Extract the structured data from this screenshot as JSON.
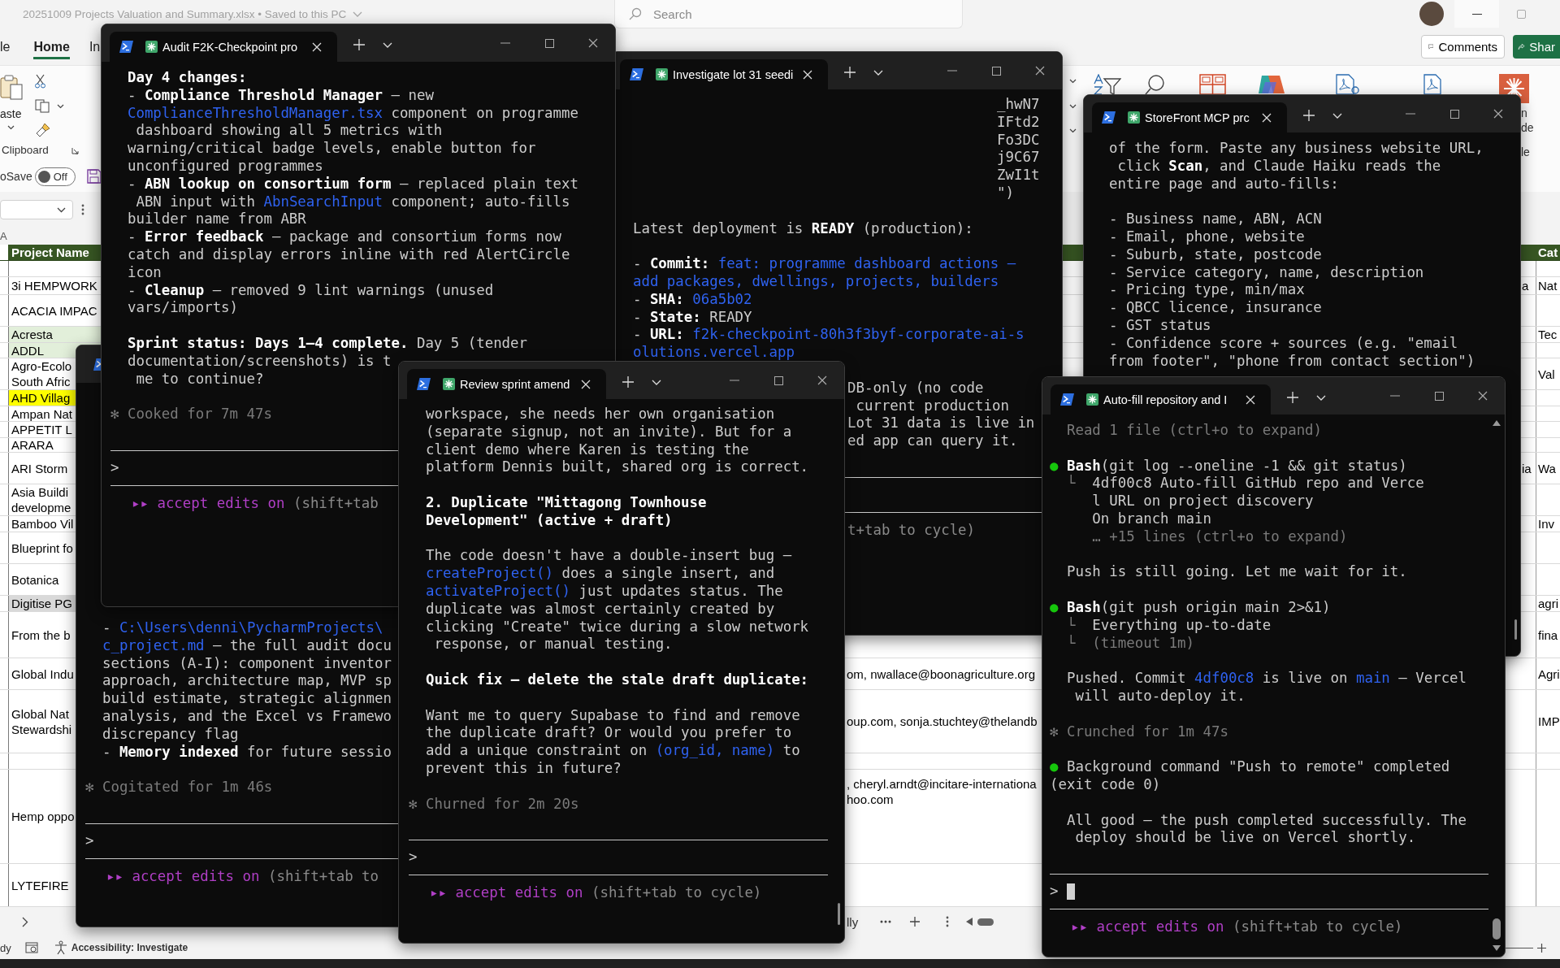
{
  "excel": {
    "title": "20251009 Projects Valuation and Summary.xlsx • Saved to this PC",
    "search": {
      "placeholder": "Search"
    },
    "ribbon_tabs": [
      {
        "label": "le",
        "selected": false
      },
      {
        "label": "Home",
        "selected": true
      },
      {
        "label": "In",
        "selected": false
      }
    ],
    "comments": "Comments",
    "share": "Shar",
    "clipboard": {
      "paste": "aste",
      "group": "Clipboard"
    },
    "ribbon_fragments": [
      "n",
      "de",
      "le"
    ],
    "autosave": {
      "label": "oSave",
      "on": false,
      "state": "Off"
    },
    "column_header": "A",
    "sheet": {
      "header": "Project Name",
      "category_header": "Cat",
      "rows": [
        {
          "project_name": [
            "3i HEMPWORK"
          ],
          "prev": "a",
          "category": "Nat",
          "space_before": true
        },
        {
          "project_name": [
            "ACACIA IMPAC"
          ]
        },
        {
          "project_name": [
            "Acresta"
          ],
          "color": "#e2efda",
          "category": "Tec"
        },
        {
          "project_name": [
            "ADDL"
          ],
          "color": "#e2efda"
        },
        {
          "project_name": [
            "Agro-Ecolo",
            "South Afric"
          ],
          "category": "Val"
        },
        {
          "project_name": [
            "AHD Villag"
          ],
          "color": "#ffff00"
        },
        {
          "project_name": [
            "Ampan Nat"
          ]
        },
        {
          "project_name": [
            "APPETIT L"
          ]
        },
        {
          "project_name": [
            "ARARA"
          ]
        },
        {
          "project_name": [
            "ARI Storm"
          ],
          "prev": "ia",
          "category": "Wa"
        },
        {
          "project_name": [
            "Asia Buildi",
            "developme"
          ]
        },
        {
          "project_name": [
            "Bamboo Vil"
          ],
          "category": "Inv"
        },
        {
          "project_name": [
            "Blueprint fo"
          ]
        },
        {
          "project_name": [
            "Botanica"
          ]
        },
        {
          "project_name": [
            "Digitise PG"
          ],
          "color": "#d9d9d9",
          "category": "agri"
        },
        {
          "project_name": [
            "From the b"
          ],
          "category": "fina"
        },
        {
          "project_name": [
            "Global Indu"
          ],
          "contact": [
            "om, nwallace@boonagriculture.org"
          ],
          "category": "Agri"
        },
        {
          "project_name": [
            "Global Nat",
            "Stewardshi"
          ],
          "contact": [
            "oup.com, sonja.stuchtey@thelandb"
          ],
          "category": "IMP"
        },
        {
          "project_name": [
            "Hemp oppo"
          ],
          "contact": [
            ", cheryl.arndt@incitare-internationa",
            "hoo.com"
          ],
          "space_before": true
        },
        {
          "project_name": [
            "LYTEFIRE"
          ]
        }
      ]
    },
    "sheet_tab": "lly",
    "status": {
      "mode": "dy",
      "accessibility": "Accessibility: Investigate"
    }
  },
  "terminals": [
    {
      "kind": "stub",
      "lines": [
        {
          "kind": "text",
          "parts": [
            {
              "text": "- "
            },
            {
              "text": "C:\\Users\\denni\\PycharmProjects\\",
              "kind": "code"
            }
          ]
        },
        {
          "kind": "text",
          "parts": [
            {
              "text": "c_project.md",
              "kind": "code"
            },
            {
              "text": " — the full audit docu"
            }
          ]
        },
        {
          "kind": "text",
          "parts": [
            {
              "text": "sections (A-I): component inventor"
            }
          ]
        },
        {
          "kind": "text",
          "parts": [
            {
              "text": "approach, architecture map, MVP sp"
            }
          ]
        },
        {
          "kind": "text",
          "parts": [
            {
              "text": "build estimate, strategic alignmen"
            }
          ]
        },
        {
          "kind": "text",
          "parts": [
            {
              "text": "analysis, and the Excel vs Framewo"
            }
          ]
        },
        {
          "kind": "text",
          "parts": [
            {
              "text": "discrepancy flag"
            }
          ]
        },
        {
          "kind": "text",
          "parts": [
            {
              "text": "- "
            },
            {
              "text": "Memory indexed",
              "kind": "bold"
            },
            {
              "text": " for future sessio"
            }
          ]
        },
        {
          "kind": "status",
          "gap": true,
          "parts": [
            {
              "text": "✻ Cogitated for 1m 46s",
              "kind": "dim"
            }
          ]
        }
      ],
      "footer": {
        "prompt": ">",
        "mode": "▸▸ accept edits on",
        "hint": "(shift+tab to"
      }
    },
    {
      "kind": "full",
      "title": "Investigate lot 31 seedi",
      "lines": [
        {
          "kind": "tail",
          "parts": [
            {
              "text": "_hwN7"
            }
          ]
        },
        {
          "kind": "tail",
          "parts": [
            {
              "text": "IFtd2"
            }
          ]
        },
        {
          "kind": "tail",
          "parts": [
            {
              "text": "Fo3DC"
            }
          ]
        },
        {
          "kind": "tail",
          "parts": [
            {
              "text": "j9C67"
            }
          ]
        },
        {
          "kind": "tail",
          "parts": [
            {
              "text": "ZwI1t"
            }
          ]
        },
        {
          "kind": "tail",
          "parts": [
            {
              "text": "\")"
            }
          ]
        },
        {
          "kind": "text",
          "gap": true,
          "parts": [
            {
              "text": "Latest deployment is "
            },
            {
              "text": "READY",
              "kind": "bold"
            },
            {
              "text": " (production):"
            }
          ]
        },
        {
          "kind": "text",
          "gap": true,
          "parts": [
            {
              "text": "- "
            },
            {
              "text": "Commit:",
              "kind": "bold"
            },
            {
              "text": " feat: programme dashboard actions —",
              "kind": "code"
            }
          ]
        },
        {
          "kind": "text",
          "parts": [
            {
              "text": "add packages, dwellings, projects, builders",
              "kind": "code"
            }
          ]
        },
        {
          "kind": "text",
          "parts": [
            {
              "text": "- "
            },
            {
              "text": "SHA:",
              "kind": "bold"
            },
            {
              "text": " 06a5b02",
              "kind": "code"
            }
          ]
        },
        {
          "kind": "text",
          "parts": [
            {
              "text": "- "
            },
            {
              "text": "State:",
              "kind": "bold"
            },
            {
              "text": " READY"
            }
          ]
        },
        {
          "kind": "text",
          "parts": [
            {
              "text": "- "
            },
            {
              "text": "URL:",
              "kind": "bold"
            },
            {
              "text": " f2k-checkpoint-80h3f3byf-corporate-ai-s",
              "kind": "code"
            }
          ]
        },
        {
          "kind": "text",
          "parts": [
            {
              "text": "olutions.vercel.app",
              "kind": "code"
            }
          ]
        },
        {
          "kind": "shifted",
          "gap": true,
          "parts": [
            {
              "text": "DB-only (no code"
            }
          ]
        },
        {
          "kind": "shifted",
          "parts": [
            {
              "text": " current production"
            }
          ]
        },
        {
          "kind": "shifted",
          "parts": [
            {
              "text": "Lot 31 data is live in"
            }
          ]
        },
        {
          "kind": "shifted",
          "parts": [
            {
              "text": "ed app can query it."
            }
          ]
        }
      ],
      "footer": {
        "hint": "t+tab to cycle)"
      }
    },
    {
      "kind": "full",
      "title": "Audit F2K-Checkpoint pro",
      "lines": [
        {
          "kind": "text",
          "parts": [
            {
              "text": "Day 4 changes:",
              "kind": "bold"
            }
          ]
        },
        {
          "kind": "text",
          "parts": [
            {
              "text": "- "
            },
            {
              "text": "Compliance Threshold Manager",
              "kind": "bold"
            },
            {
              "text": " — new"
            }
          ]
        },
        {
          "kind": "text",
          "parts": [
            {
              "text": "ComplianceThresholdManager.tsx",
              "kind": "code"
            },
            {
              "text": " component on programme"
            }
          ]
        },
        {
          "kind": "text",
          "parts": [
            {
              "text": " dashboard showing all 5 metrics with"
            }
          ]
        },
        {
          "kind": "text",
          "parts": [
            {
              "text": "warning/critical badge levels, enable button for"
            }
          ]
        },
        {
          "kind": "text",
          "parts": [
            {
              "text": "unconfigured programmes"
            }
          ]
        },
        {
          "kind": "text",
          "parts": [
            {
              "text": "- "
            },
            {
              "text": "ABN lookup on consortium form",
              "kind": "bold"
            },
            {
              "text": " — replaced plain text"
            }
          ]
        },
        {
          "kind": "text",
          "parts": [
            {
              "text": " ABN input with "
            },
            {
              "text": "AbnSearchInput",
              "kind": "code"
            },
            {
              "text": " component; auto-fills"
            }
          ]
        },
        {
          "kind": "text",
          "parts": [
            {
              "text": "builder name from ABR"
            }
          ]
        },
        {
          "kind": "text",
          "parts": [
            {
              "text": "- "
            },
            {
              "text": "Error feedback",
              "kind": "bold"
            },
            {
              "text": " — package and consortium forms now"
            }
          ]
        },
        {
          "kind": "text",
          "parts": [
            {
              "text": "catch and display errors inline with red AlertCircle"
            }
          ]
        },
        {
          "kind": "text",
          "parts": [
            {
              "text": "icon"
            }
          ]
        },
        {
          "kind": "text",
          "parts": [
            {
              "text": "- "
            },
            {
              "text": "Cleanup",
              "kind": "bold"
            },
            {
              "text": " — removed 9 lint warnings (unused"
            }
          ]
        },
        {
          "kind": "text",
          "parts": [
            {
              "text": "vars/imports)"
            }
          ]
        },
        {
          "kind": "text",
          "gap": true,
          "parts": [
            {
              "text": "Sprint status: Days 1–4 complete.",
              "kind": "bold"
            },
            {
              "text": " Day 5 (tender"
            }
          ]
        },
        {
          "kind": "text",
          "parts": [
            {
              "text": "documentation/screenshots) is t"
            }
          ]
        },
        {
          "kind": "text",
          "parts": [
            {
              "text": " me to continue?"
            }
          ]
        },
        {
          "kind": "status",
          "gap": true,
          "parts": [
            {
              "text": "✻ Cooked for 7m 47s",
              "kind": "dim"
            }
          ]
        }
      ],
      "footer": {
        "prompt": ">",
        "mode": "▸▸ accept edits on",
        "hint": "(shift+tab"
      }
    },
    {
      "kind": "full",
      "title": "StoreFront MCP prc",
      "scroll_thumb": true,
      "lines": [
        {
          "kind": "text",
          "parts": [
            {
              "text": "of the form. Paste any business website URL,"
            }
          ]
        },
        {
          "kind": "text",
          "parts": [
            {
              "text": " click "
            },
            {
              "text": "Scan",
              "kind": "bold"
            },
            {
              "text": ", and Claude Haiku reads the"
            }
          ]
        },
        {
          "kind": "text",
          "parts": [
            {
              "text": "entire page and auto-fills:"
            }
          ]
        },
        {
          "kind": "text",
          "gap": true,
          "parts": [
            {
              "text": "- Business name, ABN, ACN"
            }
          ]
        },
        {
          "kind": "text",
          "parts": [
            {
              "text": "- Email, phone, website"
            }
          ]
        },
        {
          "kind": "text",
          "parts": [
            {
              "text": "- Suburb, state, postcode"
            }
          ]
        },
        {
          "kind": "text",
          "parts": [
            {
              "text": "- Service category, name, description"
            }
          ]
        },
        {
          "kind": "text",
          "parts": [
            {
              "text": "- Pricing type, min/max"
            }
          ]
        },
        {
          "kind": "text",
          "parts": [
            {
              "text": "- QBCC licence, insurance"
            }
          ]
        },
        {
          "kind": "text",
          "parts": [
            {
              "text": "- GST status"
            }
          ]
        },
        {
          "kind": "text",
          "parts": [
            {
              "text": "- Confidence score + sources (e.g. \"email"
            }
          ]
        },
        {
          "kind": "text",
          "parts": [
            {
              "text": "from footer\", \"phone from contact section\")"
            }
          ]
        }
      ]
    },
    {
      "kind": "full",
      "title": "Review sprint amend",
      "scroll_thumb": true,
      "lines": [
        {
          "kind": "text",
          "parts": [
            {
              "text": "workspace, she needs her own organisation"
            }
          ]
        },
        {
          "kind": "text",
          "parts": [
            {
              "text": "(separate signup, not an invite). But for a"
            }
          ]
        },
        {
          "kind": "text",
          "parts": [
            {
              "text": "client demo where Karen is testing the"
            }
          ]
        },
        {
          "kind": "text",
          "parts": [
            {
              "text": "platform Dennis built, shared org is correct."
            }
          ]
        },
        {
          "kind": "text",
          "gap": true,
          "parts": [
            {
              "text": "2. Duplicate \"Mittagong Townhouse",
              "kind": "bold"
            }
          ]
        },
        {
          "kind": "text",
          "parts": [
            {
              "text": "Development\" (active + draft)",
              "kind": "bold"
            }
          ]
        },
        {
          "kind": "text",
          "gap": true,
          "parts": [
            {
              "text": "The code doesn't have a double-insert bug —"
            }
          ]
        },
        {
          "kind": "text",
          "parts": [
            {
              "text": "createProject()",
              "kind": "code"
            },
            {
              "text": " does a single insert, and"
            }
          ]
        },
        {
          "kind": "text",
          "parts": [
            {
              "text": "activateProject()",
              "kind": "code"
            },
            {
              "text": " just updates status. The"
            }
          ]
        },
        {
          "kind": "text",
          "parts": [
            {
              "text": "duplicate was almost certainly created by"
            }
          ]
        },
        {
          "kind": "text",
          "parts": [
            {
              "text": "clicking \"Create\" twice during a slow network"
            }
          ]
        },
        {
          "kind": "text",
          "parts": [
            {
              "text": " response, or manual testing."
            }
          ]
        },
        {
          "kind": "text",
          "gap": true,
          "parts": [
            {
              "text": "Quick fix — delete the stale draft duplicate:",
              "kind": "bold"
            }
          ]
        },
        {
          "kind": "text",
          "gap": true,
          "parts": [
            {
              "text": "Want me to query Supabase to find and remove"
            }
          ]
        },
        {
          "kind": "text",
          "parts": [
            {
              "text": "the duplicate draft? Or would you prefer to"
            }
          ]
        },
        {
          "kind": "text",
          "parts": [
            {
              "text": "add a unique constraint on "
            },
            {
              "text": "(org_id, name)",
              "kind": "code"
            },
            {
              "text": " to"
            }
          ]
        },
        {
          "kind": "text",
          "parts": [
            {
              "text": "prevent this in future?"
            }
          ]
        },
        {
          "kind": "status",
          "gap": true,
          "parts": [
            {
              "text": "✻ Churned for 2m 20s",
              "kind": "dim"
            }
          ]
        }
      ],
      "footer": {
        "prompt": ">",
        "mode": "▸▸ accept edits on",
        "hint": "(shift+tab to cycle)"
      }
    },
    {
      "kind": "full",
      "title": "Auto-fill repository and I",
      "scroll_arrows": true,
      "lines": [
        {
          "kind": "text",
          "parts": [
            {
              "text": "Read 1 file (ctrl+o to expand)",
              "kind": "dim"
            }
          ]
        },
        {
          "kind": "bullet",
          "gap": true,
          "parts": [
            {
              "text": "● ",
              "kind": "dot"
            },
            {
              "text": "Bash",
              "kind": "bold"
            },
            {
              "text": "(git log --oneline -1 && git status)"
            }
          ]
        },
        {
          "kind": "detail",
          "parts": [
            {
              "text": "└  ",
              "kind": "dim"
            },
            {
              "text": "4df00c8 Auto-fill GitHub repo and Verce"
            }
          ]
        },
        {
          "kind": "cont",
          "parts": [
            {
              "text": "l URL on project discovery"
            }
          ]
        },
        {
          "kind": "cont",
          "parts": [
            {
              "text": "On branch main"
            }
          ]
        },
        {
          "kind": "cont",
          "parts": [
            {
              "text": "… +15 lines (ctrl+o to expand)",
              "kind": "dim"
            }
          ]
        },
        {
          "kind": "text",
          "gap": true,
          "parts": [
            {
              "text": "Push is still going. Let me wait for it."
            }
          ]
        },
        {
          "kind": "bullet",
          "gap": true,
          "parts": [
            {
              "text": "● ",
              "kind": "dot"
            },
            {
              "text": "Bash",
              "kind": "bold"
            },
            {
              "text": "(git push origin main 2>&1)"
            }
          ]
        },
        {
          "kind": "detail",
          "parts": [
            {
              "text": "└  ",
              "kind": "dim"
            },
            {
              "text": "Everything up-to-date"
            }
          ]
        },
        {
          "kind": "detail",
          "parts": [
            {
              "text": "└  (timeout 1m)",
              "kind": "dim"
            }
          ]
        },
        {
          "kind": "text",
          "gap": true,
          "parts": [
            {
              "text": "Pushed. Commit "
            },
            {
              "text": "4df00c8",
              "kind": "code"
            },
            {
              "text": " is live on "
            },
            {
              "text": "main",
              "kind": "code"
            },
            {
              "text": " — Vercel"
            }
          ]
        },
        {
          "kind": "text",
          "parts": [
            {
              "text": " will auto-deploy it."
            }
          ]
        },
        {
          "kind": "status",
          "gap": true,
          "parts": [
            {
              "text": "✻ Crunched for 1m 47s",
              "kind": "dim"
            }
          ]
        },
        {
          "kind": "bullet",
          "gap": true,
          "parts": [
            {
              "text": "●",
              "kind": "dot"
            },
            {
              "text": " Background command \"Push to remote\" completed"
            }
          ]
        },
        {
          "kind": "status",
          "parts": [
            {
              "text": "(exit code 0)"
            }
          ]
        },
        {
          "kind": "text",
          "gap": true,
          "parts": [
            {
              "text": "All good — the push completed successfully. The"
            }
          ]
        },
        {
          "kind": "text",
          "parts": [
            {
              "text": " deploy should be live on Vercel shortly."
            }
          ]
        }
      ],
      "footer": {
        "prompt": ">",
        "cursor": true,
        "mode": "▸▸ accept edits on",
        "hint": "(shift+tab to cycle)"
      }
    }
  ]
}
